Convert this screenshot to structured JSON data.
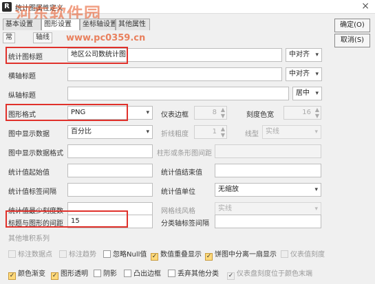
{
  "window": {
    "title": "统计图属性定义",
    "app_icon": "R",
    "close": "×"
  },
  "watermark": {
    "line1": "河东软件园",
    "line2": "www.pc0359.cn"
  },
  "tabs": [
    {
      "label": "基本设置"
    },
    {
      "label": "图形设置"
    },
    {
      "label": "坐标轴设置"
    },
    {
      "label": "其他属性"
    }
  ],
  "subtabs": [
    {
      "label": "常"
    },
    {
      "label": "轴线"
    }
  ],
  "buttons": {
    "ok": "确定(O)",
    "cancel": "取消(S)"
  },
  "form": {
    "chart_title": {
      "label": "统计图标题",
      "value": "地区公司数统计图",
      "align": "中对齐"
    },
    "x_title": {
      "label": "横轴标题",
      "value": "",
      "align": "中对齐"
    },
    "y_title": {
      "label": "纵轴标题",
      "value": "",
      "align": "居中"
    },
    "format": {
      "label": "图形格式",
      "value": "PNG"
    },
    "border": {
      "label": "仪表边框",
      "value": "8"
    },
    "scale_width": {
      "label": "刻度色宽",
      "value": "16"
    },
    "show_data": {
      "label": "图中显示数据",
      "value": "百分比"
    },
    "line_width": {
      "label": "折线粗度",
      "value": "1"
    },
    "line_type": {
      "label": "线型",
      "value": "实线"
    },
    "show_format": {
      "label": "图中显示数据格式",
      "value": ""
    },
    "bar_gap": {
      "label": "柱形或条形图间距",
      "value": ""
    },
    "start_val": {
      "label": "统计值起始值",
      "value": ""
    },
    "end_val": {
      "label": "统计值结束值",
      "value": ""
    },
    "label_gap": {
      "label": "统计值标签间隔",
      "value": ""
    },
    "unit": {
      "label": "统计值单位",
      "value": "无缩放"
    },
    "min_scale": {
      "label": "统计值最少刻度数",
      "value": ""
    },
    "grid_style": {
      "label": "网格线风格",
      "value": "实线"
    },
    "title_gap": {
      "label": "标题与图形的间距",
      "value": "15"
    },
    "cat_gap": {
      "label": "分类轴标签间隔",
      "value": ""
    },
    "other_stack": {
      "label": "其他堆积系列"
    }
  },
  "checks_row1": [
    {
      "label": "标注数据点",
      "checked": false,
      "disabled": true
    },
    {
      "label": "标注趋势",
      "checked": false,
      "disabled": true
    },
    {
      "label": "忽略Null值",
      "checked": false,
      "disabled": false
    },
    {
      "label": "数值重叠显示",
      "checked": true,
      "disabled": false
    },
    {
      "label": "饼图中分离一扇显示",
      "checked": true,
      "disabled": false
    },
    {
      "label": "仪表值刻度",
      "checked": false,
      "disabled": true
    }
  ],
  "checks_row2": [
    {
      "label": "颜色渐变",
      "checked": true,
      "disabled": false
    },
    {
      "label": "图形透明",
      "checked": true,
      "disabled": false
    },
    {
      "label": "阴影",
      "checked": false,
      "disabled": false
    },
    {
      "label": "凸出边框",
      "checked": false,
      "disabled": false
    },
    {
      "label": "丢弃其他分类",
      "checked": false,
      "disabled": false
    },
    {
      "label": "仪表盘刻度位于颜色末端",
      "checked": true,
      "disabled": true
    }
  ],
  "colors": {
    "highlight": "#e0302a",
    "check_fill": "#ffd97a"
  }
}
